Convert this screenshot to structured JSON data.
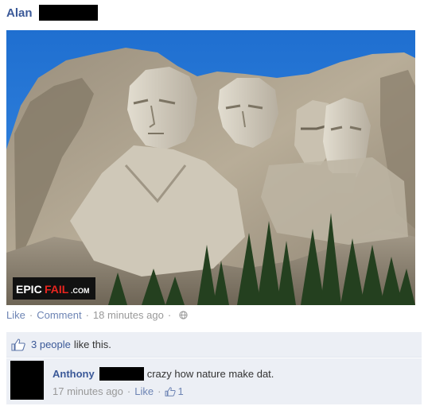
{
  "post": {
    "author": "Alan",
    "actions": {
      "like": "Like",
      "comment": "Comment",
      "timestamp": "18 minutes ago"
    },
    "likes": {
      "count_text": "3 people",
      "suffix": "like this."
    },
    "photo": {
      "watermark": "EPICFAIL.COM",
      "watermark_parts": [
        "EPIC",
        "FAIL",
        ".COM"
      ]
    }
  },
  "comment": {
    "author": "Anthony",
    "text": "crazy how nature make dat.",
    "timestamp": "17 minutes ago",
    "like_label": "Like",
    "like_count": "1"
  },
  "icons": {
    "privacy": "globe-icon",
    "like": "thumbs-up-icon"
  },
  "colors": {
    "link": "#3b5998",
    "muted_link": "#6d84b4",
    "panel": "#eceff5",
    "watermark_red": "#e8251f"
  }
}
